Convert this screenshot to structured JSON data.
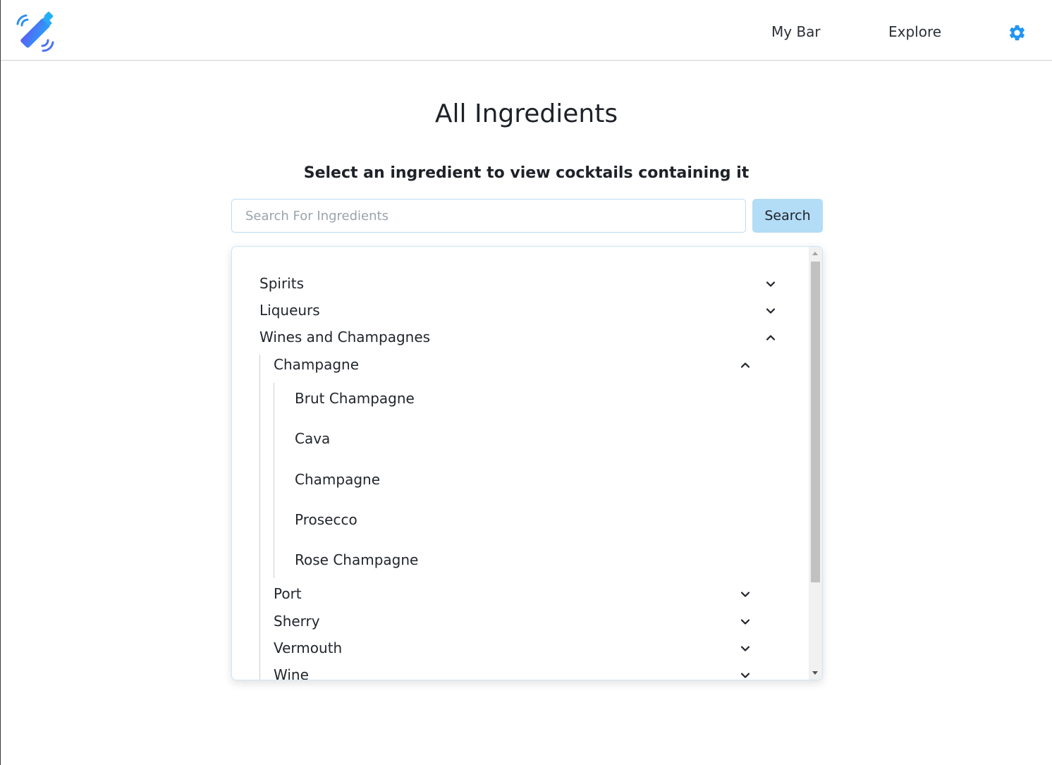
{
  "nav": {
    "logo_icon": "cocktail-shaker-logo-icon",
    "links": [
      "My Bar",
      "Explore"
    ],
    "settings_icon": "gear-icon",
    "accent_color": "#2196f3"
  },
  "main": {
    "title": "All Ingredients",
    "subtitle": "Select an ingredient to view cocktails containing it",
    "search": {
      "placeholder": "Search For Ingredients",
      "value": "",
      "button_label": "Search"
    }
  },
  "tree": {
    "categories": [
      {
        "label": "Spirits",
        "expanded": false
      },
      {
        "label": "Liqueurs",
        "expanded": false
      },
      {
        "label": "Wines and Champagnes",
        "expanded": true,
        "subcategories": [
          {
            "label": "Champagne",
            "expanded": true,
            "items": [
              "Brut Champagne",
              "Cava",
              "Champagne",
              "Prosecco",
              "Rose Champagne"
            ]
          },
          {
            "label": "Port",
            "expanded": false
          },
          {
            "label": "Sherry",
            "expanded": false
          },
          {
            "label": "Vermouth",
            "expanded": false
          },
          {
            "label": "Wine",
            "expanded": false
          }
        ]
      }
    ]
  }
}
